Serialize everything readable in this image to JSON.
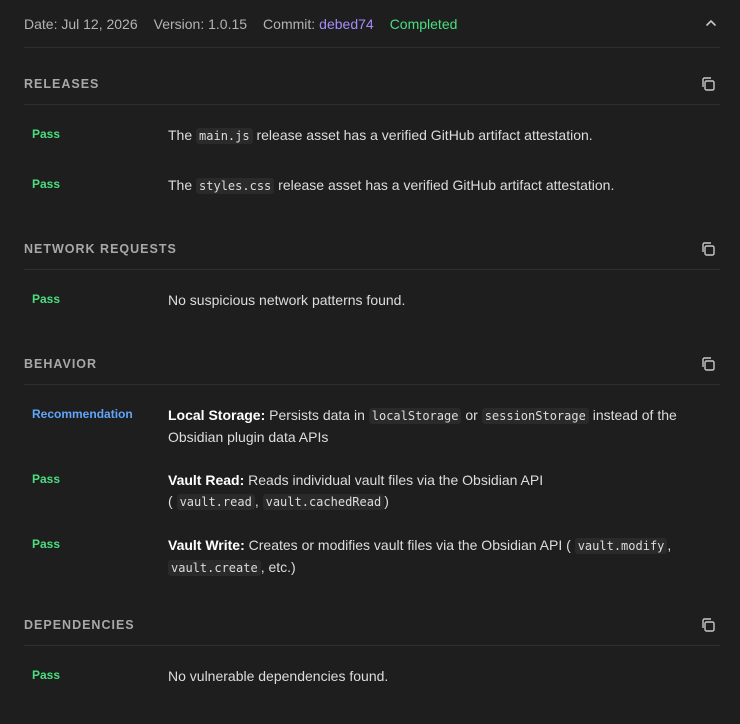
{
  "header": {
    "date": "Date: Jul 12, 2026",
    "version": "Version: 1.0.15",
    "commit_label": "Commit:",
    "commit_hash": "debed74",
    "status": "Completed"
  },
  "colors": {
    "pass": "#4ade80",
    "recommendation": "#60a5fa",
    "commit": "#a88bfa"
  },
  "icons": {
    "collapse": "chevron-up-icon",
    "copy": "copy-icon"
  },
  "sections": {
    "releases": {
      "title": "RELEASES",
      "rows": [
        {
          "badge": "Pass",
          "pre": "The",
          "code": "main.js",
          "post": "release asset has a verified GitHub artifact attestation."
        },
        {
          "badge": "Pass",
          "pre": "The",
          "code": "styles.css",
          "post": "release asset has a verified GitHub artifact attestation."
        }
      ]
    },
    "network": {
      "title": "NETWORK REQUESTS",
      "rows": [
        {
          "badge": "Pass",
          "text": "No suspicious network patterns found."
        }
      ]
    },
    "behavior": {
      "title": "BEHAVIOR",
      "rows": [
        {
          "badge": "Recommendation",
          "bold": "Local Storage:",
          "t1": "Persists data in",
          "c1": "localStorage",
          "t2": "or",
          "c2": "sessionStorage",
          "t3": "instead of the Obsidian plugin data APIs"
        },
        {
          "badge": "Pass",
          "bold": "Vault Read:",
          "t1": "Reads individual vault files via the Obsidian API",
          "t2": "(",
          "c1": "vault.read",
          "t3": ",",
          "c2": "vault.cachedRead",
          "t4": ")"
        },
        {
          "badge": "Pass",
          "bold": "Vault Write:",
          "t1": "Creates or modifies vault files via the Obsidian API (",
          "c1": "vault.modify",
          "t2": ",",
          "c2": "vault.create",
          "t3": ", etc.)"
        }
      ]
    },
    "dependencies": {
      "title": "DEPENDENCIES",
      "rows": [
        {
          "badge": "Pass",
          "text": "No vulnerable dependencies found."
        }
      ]
    }
  }
}
